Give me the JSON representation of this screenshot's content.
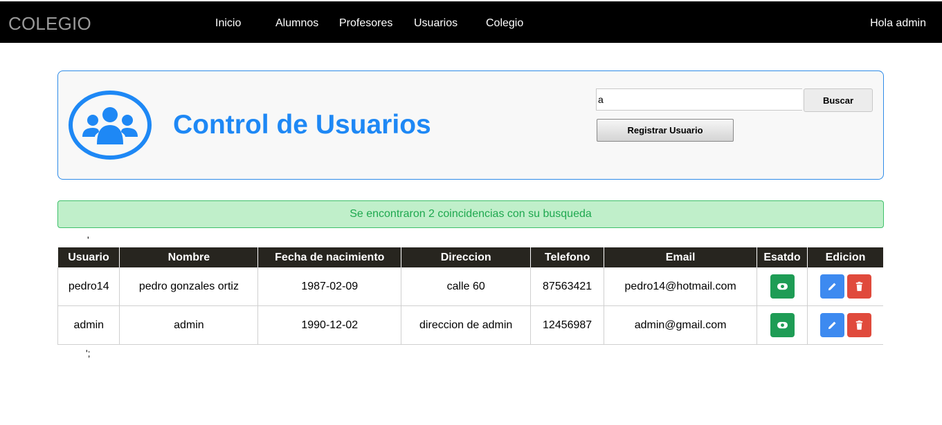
{
  "header": {
    "brand": "COLEGIO",
    "nav": [
      "Inicio",
      "Alumnos",
      "Profesores",
      "Usuarios",
      "Colegio"
    ],
    "greeting": "Hola admin"
  },
  "panel": {
    "icon": "users-group-icon",
    "title": "Control de Usuarios",
    "search_value": "a",
    "search_button": "Buscar",
    "register_button": "Registrar Usuario"
  },
  "alert": {
    "message": "Se encontraron 2 coincidencias con su busqueda"
  },
  "stray_text": {
    "before_table": "'",
    "after_table": "';"
  },
  "table": {
    "headers": [
      "Usuario",
      "Nombre",
      "Fecha de nacimiento",
      "Direccion",
      "Telefono",
      "Email",
      "Esatdo",
      "Edicion"
    ],
    "rows": [
      {
        "usuario": "pedro14",
        "nombre": "pedro gonzales ortiz",
        "fecha": "1987-02-09",
        "direccion": "calle 60",
        "telefono": "87563421",
        "email": "pedro14@hotmail.com"
      },
      {
        "usuario": "admin",
        "nombre": "admin",
        "fecha": "1990-12-02",
        "direccion": "direccion de admin",
        "telefono": "12456987",
        "email": "admin@gmail.com"
      }
    ]
  },
  "colors": {
    "topbar": "#000000",
    "accent_blue": "#1e88f5",
    "status_green": "#1e9c55",
    "edit_blue": "#3d8af0",
    "delete_red": "#e04a3c",
    "alert_bg": "#c0efca",
    "table_header": "#27251f"
  },
  "icons": {
    "status": "toggle-icon",
    "edit": "pencil-icon",
    "delete": "trash-icon"
  }
}
